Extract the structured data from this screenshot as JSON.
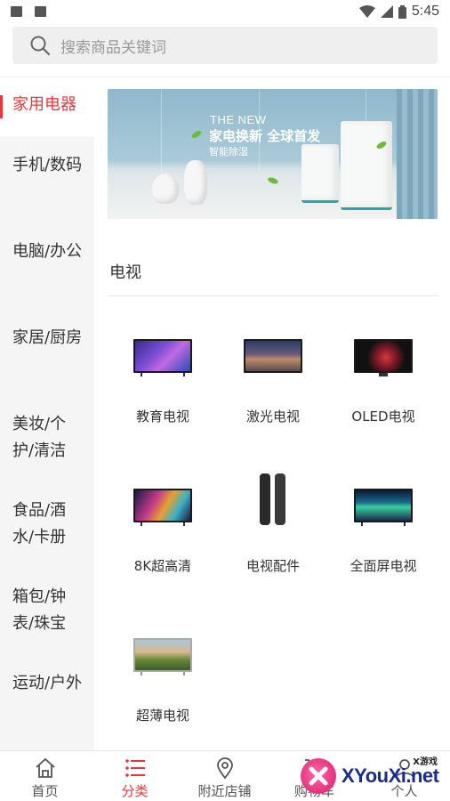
{
  "status_bar": {
    "time": "5:45"
  },
  "search": {
    "placeholder": "搜索商品关键词"
  },
  "sidebar": {
    "items": [
      {
        "label": "家用电器",
        "active": true
      },
      {
        "label": "手机/数码"
      },
      {
        "label": "电脑/办公"
      },
      {
        "label": "家居/厨房"
      },
      {
        "label": "美妆/个护/清洁"
      },
      {
        "label": "食品/酒水/卡册"
      },
      {
        "label": "箱包/钟表/珠宝"
      },
      {
        "label": "运动/户外"
      }
    ]
  },
  "banner": {
    "en": "THE NEW",
    "title": "家电换新 全球首发",
    "subtitle": "智能除湿"
  },
  "section": {
    "title": "电视",
    "items": [
      {
        "label": "教育电视",
        "icon": "tv-butterfly-icon"
      },
      {
        "label": "激光电视",
        "icon": "tv-mountain-icon"
      },
      {
        "label": "OLED电视",
        "icon": "tv-dark-icon"
      },
      {
        "label": "8K超高清",
        "icon": "tv-colorful-icon"
      },
      {
        "label": "电视配件",
        "icon": "remote-control-icon"
      },
      {
        "label": "全面屏电视",
        "icon": "tv-aurora-icon"
      },
      {
        "label": "超薄电视",
        "icon": "tv-landscape-icon"
      }
    ]
  },
  "bottom_nav": {
    "items": [
      {
        "label": "首页",
        "icon": "home-icon"
      },
      {
        "label": "分类",
        "icon": "list-icon",
        "active": true
      },
      {
        "label": "附近店铺",
        "icon": "location-pin-icon"
      },
      {
        "label": "购物车",
        "icon": "cart-icon"
      },
      {
        "label": "个人",
        "icon": "user-icon"
      }
    ]
  },
  "watermark": {
    "brand": "XYouXi.net",
    "small": "X游戏"
  },
  "colors": {
    "accent": "#e4393c",
    "sidebar_bg": "#f5f5f5",
    "search_bg": "#efefef"
  }
}
